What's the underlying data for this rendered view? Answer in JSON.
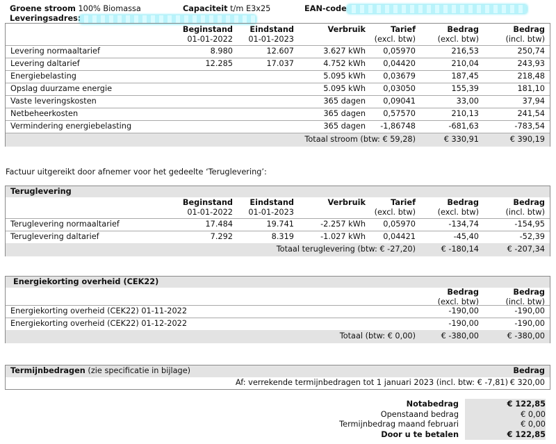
{
  "header": {
    "product_label": "Groene stroom",
    "product_value": "100% Biomassa",
    "capacity_label": "Capaciteit",
    "capacity_value": "t/m E3x25",
    "ean_label": "EAN-code",
    "address_label": "Leveringsadres:"
  },
  "columns": {
    "begin": "Beginstand",
    "begin_date": "01-01-2022",
    "end": "Eindstand",
    "end_date": "01-01-2023",
    "usage": "Verbruik",
    "tariff": "Tarief",
    "tariff_sub": "(excl. btw)",
    "amount": "Bedrag",
    "amount_excl": "(excl. btw)",
    "amount_incl": "(incl. btw)"
  },
  "stroom": {
    "rows": [
      {
        "label": "Levering normaaltarief",
        "begin": "8.980",
        "end": "12.607",
        "usage": "3.627 kWh",
        "tariff": "0,05970",
        "excl": "216,53",
        "incl": "250,74"
      },
      {
        "label": "Levering daltarief",
        "begin": "12.285",
        "end": "17.037",
        "usage": "4.752 kWh",
        "tariff": "0,04420",
        "excl": "210,04",
        "incl": "243,93"
      },
      {
        "label": "Energiebelasting",
        "begin": "",
        "end": "",
        "usage": "5.095 kWh",
        "tariff": "0,03679",
        "excl": "187,45",
        "incl": "218,48"
      },
      {
        "label": "Opslag duurzame energie",
        "begin": "",
        "end": "",
        "usage": "5.095 kWh",
        "tariff": "0,03050",
        "excl": "155,39",
        "incl": "181,10"
      },
      {
        "label": "Vaste leveringskosten",
        "begin": "",
        "end": "",
        "usage": "365 dagen",
        "tariff": "0,09041",
        "excl": "33,00",
        "incl": "37,94"
      },
      {
        "label": "Netbeheerkosten",
        "begin": "",
        "end": "",
        "usage": "365 dagen",
        "tariff": "0,57570",
        "excl": "210,13",
        "incl": "241,54"
      },
      {
        "label": "Vermindering energiebelasting",
        "begin": "",
        "end": "",
        "usage": "365 dagen",
        "tariff": "-1,86748",
        "excl": "-681,63",
        "incl": "-783,54"
      }
    ],
    "total_label": "Totaal stroom (btw: € 59,28)",
    "total_excl": "€ 330,91",
    "total_incl": "€ 390,19"
  },
  "note_text": "Factuur uitgereikt door afnemer voor het gedeelte ‘Teruglevering’:",
  "teruglevering": {
    "title": "Teruglevering",
    "rows": [
      {
        "label": "Teruglevering normaaltarief",
        "begin": "17.484",
        "end": "19.741",
        "usage": "-2.257 kWh",
        "tariff": "0,05970",
        "excl": "-134,74",
        "incl": "-154,95"
      },
      {
        "label": "Teruglevering daltarief",
        "begin": "7.292",
        "end": "8.319",
        "usage": "-1.027 kWh",
        "tariff": "0,04421",
        "excl": "-45,40",
        "incl": "-52,39"
      }
    ],
    "total_label": "Totaal teruglevering (btw: € -27,20)",
    "total_excl": "€ -180,14",
    "total_incl": "€ -207,34"
  },
  "korting": {
    "title": "Energiekorting overheid (CEK22)",
    "rows": [
      {
        "label": "Energiekorting overheid (CEK22) 01-11-2022",
        "excl": "-190,00",
        "incl": "-190,00"
      },
      {
        "label": "Energiekorting overheid (CEK22) 01-12-2022",
        "excl": "-190,00",
        "incl": "-190,00"
      }
    ],
    "total_label": "Totaal (btw: € 0,00)",
    "total_excl": "€ -380,00",
    "total_incl": "€ -380,00"
  },
  "termijn": {
    "title": "Termijnbedragen",
    "subtitle": "(zie specificatie in bijlage)",
    "amount_header": "Bedrag",
    "row_label": "Af: verrekende termijnbedragen tot 1 januari 2023 (incl. btw: € -7,81)",
    "row_amount": "€  320,00"
  },
  "summary": [
    {
      "label": "Notabedrag",
      "value": "€ 122,85",
      "bold": true
    },
    {
      "label": "Openstaand bedrag",
      "value": "€ 0,00",
      "bold": false
    },
    {
      "label": "Termijnbedrag maand februari",
      "value": "€ 0,00",
      "bold": false
    },
    {
      "label": "Door u te betalen",
      "value": "€ 122,85",
      "bold": true
    }
  ]
}
